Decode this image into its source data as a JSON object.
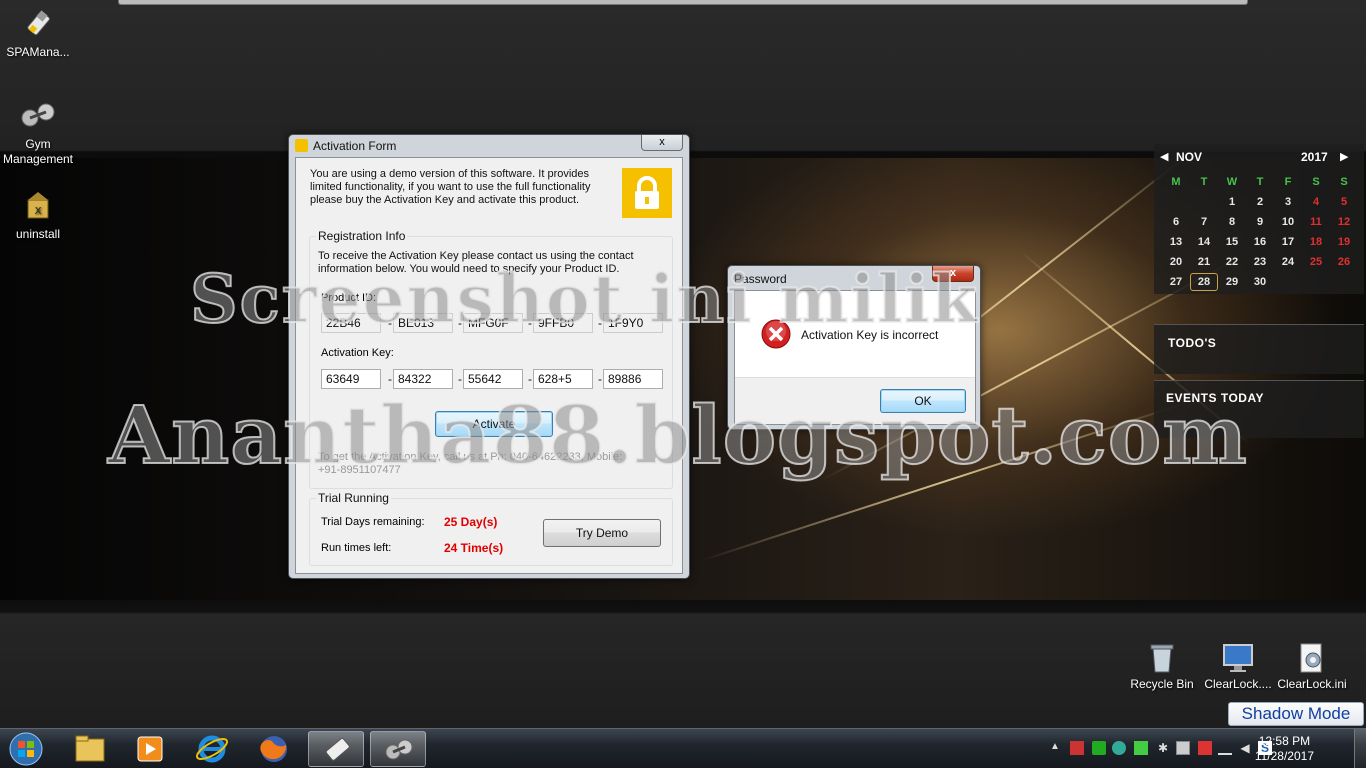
{
  "desktop": {
    "icons": [
      {
        "label": "SPAMana..."
      },
      {
        "label": "Gym Management"
      },
      {
        "label": "uninstall"
      },
      {
        "label": "Recycle Bin"
      },
      {
        "label": "ClearLock...."
      },
      {
        "label": "ClearLock.ini"
      }
    ],
    "watermark_line1": "Screenshot ini milik",
    "watermark_line2": "Anantha88.blogspot.com",
    "shadow_mode": "Shadow Mode"
  },
  "activation_form": {
    "title": "Activation Form",
    "close": "x",
    "intro": "You are using a demo version of this software. It provides limited functionality, if you want to use the full functionality please buy the Activation Key and activate this product.",
    "registration_legend": "Registration Info",
    "registration_text": "To receive the Activation Key please contact us using the contact information below. You would need to specify your Product ID.",
    "product_id_label": "Product ID:",
    "product_id": [
      "22B46",
      "BE013",
      "MFG0F",
      "9FFB0",
      "1F9Y0"
    ],
    "activation_key_label": "Activation Key:",
    "activation_key": [
      "63649",
      "84322",
      "55642",
      "628+5",
      "89886"
    ],
    "separator": "-",
    "activate_label": "Activate",
    "contact_text": "To get the Activation Key, call us at Ph: 040-64622233, Mobile: +91-8951107477",
    "trial_legend": "Trial Running",
    "trial_days_label": "Trial Days remaining:",
    "trial_days_value": "25 Day(s)",
    "run_times_label": "Run times left:",
    "run_times_value": "24 Time(s)",
    "try_demo_label": "Try Demo"
  },
  "password_dialog": {
    "title": "Password",
    "close": "x",
    "message": "Activation Key is incorrect",
    "ok_label": "OK"
  },
  "calendar": {
    "month": "NOV",
    "year": "2017",
    "weekdays": [
      "M",
      "T",
      "W",
      "T",
      "F",
      "S",
      "S"
    ],
    "weeks": [
      [
        "",
        "",
        "1",
        "2",
        "3",
        "4",
        "5"
      ],
      [
        "6",
        "7",
        "8",
        "9",
        "10",
        "11",
        "12"
      ],
      [
        "13",
        "14",
        "15",
        "16",
        "17",
        "18",
        "19"
      ],
      [
        "20",
        "21",
        "22",
        "23",
        "24",
        "25",
        "26"
      ],
      [
        "27",
        "28",
        "29",
        "30",
        "",
        "",
        ""
      ]
    ],
    "today": "28",
    "todos_label": "TODO'S",
    "events_label": "EVENTS TODAY"
  },
  "taskbar": {
    "time": "12:58 PM",
    "date": "11/28/2017"
  },
  "colors": {
    "accent_yellow": "#f5c000",
    "error_red": "#e00000",
    "calendar_green": "#49c14d"
  }
}
